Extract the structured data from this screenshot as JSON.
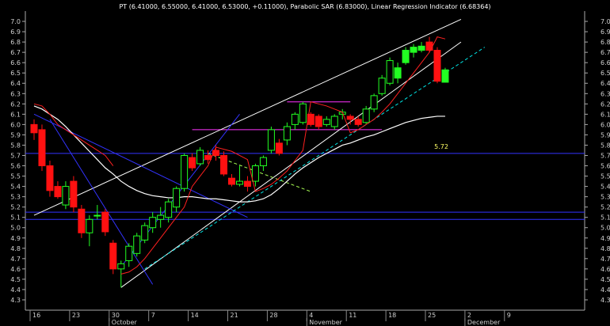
{
  "header": {
    "title": "PT (6.41000, 6.55000, 6.41000, 6.53000, +0.11000), Parabolic SAR (6.83000), Linear Regression Indicator (6.68364)"
  },
  "chart_data": {
    "type": "candlestick",
    "title": "PT (6.41000, 6.55000, 6.41000, 6.53000, +0.11000), Parabolic SAR (6.83000), Linear Regression Indicator (6.68364)",
    "ylim": [
      4.2,
      7.1
    ],
    "y_ticks": [
      "7.0",
      "6.9",
      "6.8",
      "6.7",
      "6.6",
      "6.5",
      "6.4",
      "6.3",
      "6.2",
      "6.1",
      "6.0",
      "5.9",
      "5.8",
      "5.7",
      "5.6",
      "5.5",
      "5.4",
      "5.3",
      "5.2",
      "5.1",
      "5.0",
      "4.9",
      "4.8",
      "4.7",
      "4.6",
      "4.5",
      "4.4",
      "4.3"
    ],
    "x_ticks": [
      "16",
      "23",
      "30",
      "7",
      "14",
      "21",
      "28",
      "4",
      "11",
      "18",
      "25",
      "2",
      "9"
    ],
    "months": [
      "October",
      "November",
      "December"
    ],
    "annotation": "5.72",
    "colors": {
      "up": "#22ff22",
      "down": "#ff1111",
      "doji": "#ffffff",
      "sar": "#ff2020",
      "ma": "#ffffff",
      "hline": "#3333ff",
      "trend": "#ffffff",
      "dash": "#00e5e5",
      "resist": "#ff33ff"
    },
    "candles": [
      {
        "o": 6.0,
        "h": 6.05,
        "l": 5.85,
        "c": 5.92
      },
      {
        "o": 5.95,
        "h": 6.0,
        "l": 5.55,
        "c": 5.6
      },
      {
        "o": 5.6,
        "h": 5.65,
        "l": 5.3,
        "c": 5.36
      },
      {
        "o": 5.4,
        "h": 5.45,
        "l": 5.28,
        "c": 5.3
      },
      {
        "o": 5.22,
        "h": 5.45,
        "l": 5.18,
        "c": 5.4
      },
      {
        "o": 5.45,
        "h": 5.5,
        "l": 5.15,
        "c": 5.2
      },
      {
        "o": 5.18,
        "h": 5.22,
        "l": 4.9,
        "c": 4.95
      },
      {
        "o": 4.95,
        "h": 5.12,
        "l": 4.82,
        "c": 5.08
      },
      {
        "o": 5.12,
        "h": 5.22,
        "l": 5.08,
        "c": 5.12
      },
      {
        "o": 5.15,
        "h": 5.18,
        "l": 4.92,
        "c": 4.96
      },
      {
        "o": 4.85,
        "h": 4.88,
        "l": 4.55,
        "c": 4.6
      },
      {
        "o": 4.6,
        "h": 4.68,
        "l": 4.42,
        "c": 4.65
      },
      {
        "o": 4.68,
        "h": 4.85,
        "l": 4.62,
        "c": 4.82
      },
      {
        "o": 4.75,
        "h": 4.95,
        "l": 4.72,
        "c": 4.92
      },
      {
        "o": 4.88,
        "h": 5.05,
        "l": 4.85,
        "c": 5.02
      },
      {
        "o": 5.0,
        "h": 5.15,
        "l": 4.95,
        "c": 5.1
      },
      {
        "o": 5.08,
        "h": 5.2,
        "l": 5.0,
        "c": 5.12
      },
      {
        "o": 5.1,
        "h": 5.28,
        "l": 5.05,
        "c": 5.25
      },
      {
        "o": 5.2,
        "h": 5.4,
        "l": 5.15,
        "c": 5.38
      },
      {
        "o": 5.38,
        "h": 5.72,
        "l": 5.35,
        "c": 5.7
      },
      {
        "o": 5.68,
        "h": 5.72,
        "l": 5.55,
        "c": 5.58
      },
      {
        "o": 5.62,
        "h": 5.78,
        "l": 5.6,
        "c": 5.75
      },
      {
        "o": 5.7,
        "h": 5.75,
        "l": 5.62,
        "c": 5.66
      },
      {
        "o": 5.75,
        "h": 5.8,
        "l": 5.65,
        "c": 5.7
      },
      {
        "o": 5.7,
        "h": 5.74,
        "l": 5.5,
        "c": 5.52
      },
      {
        "o": 5.48,
        "h": 5.52,
        "l": 5.4,
        "c": 5.42
      },
      {
        "o": 5.42,
        "h": 5.6,
        "l": 5.4,
        "c": 5.45
      },
      {
        "o": 5.45,
        "h": 5.5,
        "l": 5.35,
        "c": 5.4
      },
      {
        "o": 5.45,
        "h": 5.62,
        "l": 5.4,
        "c": 5.6
      },
      {
        "o": 5.6,
        "h": 5.7,
        "l": 5.55,
        "c": 5.68
      },
      {
        "o": 5.75,
        "h": 5.98,
        "l": 5.72,
        "c": 5.95
      },
      {
        "o": 5.82,
        "h": 5.86,
        "l": 5.7,
        "c": 5.72
      },
      {
        "o": 5.85,
        "h": 6.02,
        "l": 5.8,
        "c": 5.98
      },
      {
        "o": 6.0,
        "h": 6.12,
        "l": 5.95,
        "c": 6.1
      },
      {
        "o": 6.02,
        "h": 6.22,
        "l": 6.0,
        "c": 6.2
      },
      {
        "o": 6.1,
        "h": 6.12,
        "l": 5.98,
        "c": 6.0
      },
      {
        "o": 6.08,
        "h": 6.1,
        "l": 5.95,
        "c": 5.98
      },
      {
        "o": 6.0,
        "h": 6.08,
        "l": 5.98,
        "c": 6.05
      },
      {
        "o": 5.98,
        "h": 6.1,
        "l": 5.95,
        "c": 6.08
      },
      {
        "o": 6.1,
        "h": 6.15,
        "l": 6.05,
        "c": 6.12
      },
      {
        "o": 6.08,
        "h": 6.1,
        "l": 6.0,
        "c": 6.05
      },
      {
        "o": 6.05,
        "h": 6.08,
        "l": 5.98,
        "c": 6.0
      },
      {
        "o": 6.02,
        "h": 6.18,
        "l": 6.0,
        "c": 6.15
      },
      {
        "o": 6.15,
        "h": 6.3,
        "l": 6.12,
        "c": 6.28
      },
      {
        "o": 6.3,
        "h": 6.48,
        "l": 6.28,
        "c": 6.45
      },
      {
        "o": 6.4,
        "h": 6.65,
        "l": 6.38,
        "c": 6.62
      },
      {
        "o": 6.45,
        "h": 6.6,
        "l": 6.4,
        "c": 6.55
      },
      {
        "o": 6.6,
        "h": 6.75,
        "l": 6.58,
        "c": 6.72
      },
      {
        "o": 6.7,
        "h": 6.78,
        "l": 6.65,
        "c": 6.75
      },
      {
        "o": 6.72,
        "h": 6.8,
        "l": 6.7,
        "c": 6.76
      },
      {
        "o": 6.8,
        "h": 6.85,
        "l": 6.7,
        "c": 6.72
      },
      {
        "o": 6.72,
        "h": 6.75,
        "l": 6.4,
        "c": 6.42
      },
      {
        "o": 6.41,
        "h": 6.55,
        "l": 6.41,
        "c": 6.53
      }
    ],
    "sar": [
      6.2,
      6.18,
      6.1,
      6.0,
      5.95,
      5.9,
      5.85,
      5.8,
      5.75,
      5.7,
      5.6,
      4.55,
      4.57,
      4.62,
      4.7,
      4.8,
      4.9,
      5.0,
      5.1,
      5.2,
      5.4,
      5.5,
      5.6,
      5.78,
      5.76,
      5.74,
      5.7,
      5.66,
      5.35,
      5.38,
      5.42,
      5.48,
      5.55,
      5.65,
      5.75,
      6.22,
      6.2,
      6.18,
      6.15,
      6.12,
      5.92,
      5.95,
      6.0,
      6.05,
      6.12,
      6.2,
      6.3,
      6.4,
      6.5,
      6.6,
      6.7,
      6.85,
      6.83
    ],
    "ma": [
      6.18,
      6.15,
      6.1,
      6.05,
      5.98,
      5.9,
      5.82,
      5.74,
      5.66,
      5.58,
      5.52,
      5.45,
      5.4,
      5.36,
      5.33,
      5.31,
      5.3,
      5.29,
      5.29,
      5.3,
      5.3,
      5.29,
      5.28,
      5.28,
      5.27,
      5.26,
      5.25,
      5.25,
      5.26,
      5.28,
      5.32,
      5.38,
      5.45,
      5.52,
      5.58,
      5.63,
      5.68,
      5.72,
      5.76,
      5.8,
      5.82,
      5.85,
      5.88,
      5.9,
      5.93,
      5.96,
      5.99,
      6.02,
      6.04,
      6.06,
      6.07,
      6.08,
      6.08
    ],
    "horizontal_lines": [
      5.72,
      5.15,
      5.08
    ],
    "resistance": {
      "y": 5.95,
      "from": 20,
      "to": 44
    },
    "resistance_top": {
      "y": 6.22,
      "from": 32,
      "to": 40
    },
    "trend_lines": [
      {
        "x1": 0,
        "y1": 5.12,
        "x2": 54,
        "y2": 7.02
      },
      {
        "x1": 11,
        "y1": 4.42,
        "x2": 54,
        "y2": 6.8
      },
      {
        "x1": 2,
        "y1": 6.05,
        "x2": 15,
        "y2": 4.45
      },
      {
        "x1": 0,
        "y1": 6.1,
        "x2": 27,
        "y2": 5.1
      },
      {
        "x1": 11,
        "y1": 4.62,
        "x2": 26,
        "y2": 6.1
      }
    ],
    "dashed_lines": [
      {
        "x1": 14,
        "y1": 4.6,
        "x2": 57,
        "y2": 6.75
      },
      {
        "x1": 22,
        "y1": 5.72,
        "x2": 35,
        "y2": 5.35
      }
    ]
  }
}
